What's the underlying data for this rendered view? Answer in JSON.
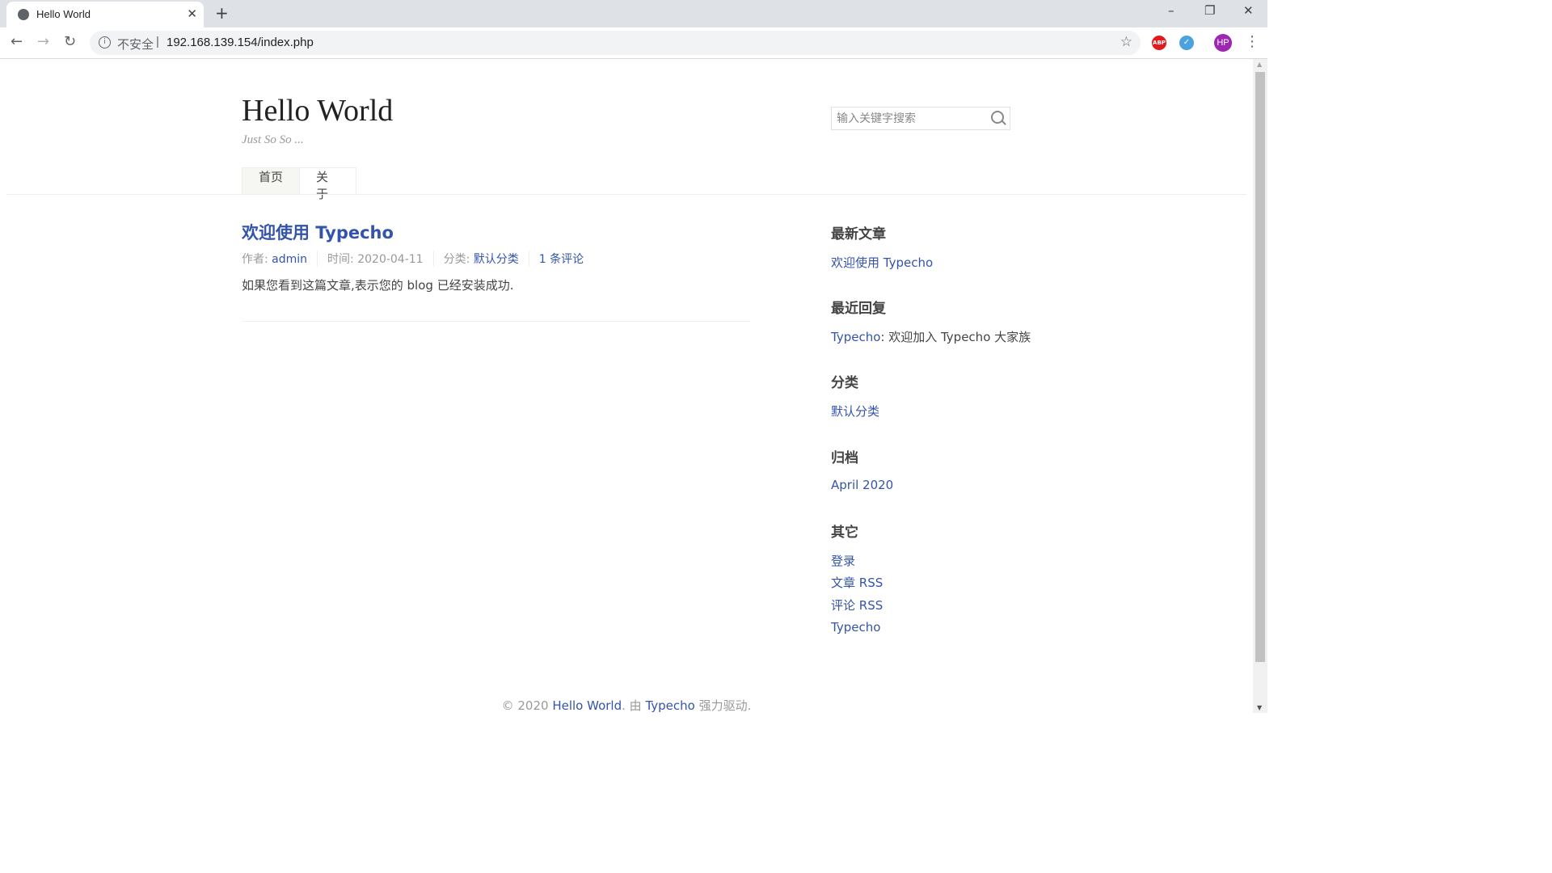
{
  "browser": {
    "tab_title": "Hello World",
    "tab_close": "✕",
    "new_tab": "+",
    "window": {
      "minimize": "–",
      "restore": "❐",
      "close": "✕"
    },
    "nav": {
      "back": "←",
      "forward": "→",
      "reload": "↻"
    },
    "info_icon": "i",
    "security_label": "不安全",
    "separator": "|",
    "url": "192.168.139.154/index.php",
    "bookmark_star": "☆",
    "extensions": {
      "abp": "ABP",
      "second": "✓"
    },
    "profile_initials": "HP",
    "menu": "⋮"
  },
  "site": {
    "title": "Hello World",
    "description": "Just So So ...",
    "search_placeholder": "输入关键字搜索",
    "nav": [
      {
        "label": "首页",
        "active": true
      },
      {
        "label": "关于",
        "active": false
      }
    ]
  },
  "post": {
    "title": "欢迎使用 Typecho",
    "author_label": "作者: ",
    "author": "admin",
    "time_label": "时间: ",
    "time": "2020-04-11",
    "category_label": "分类: ",
    "category": "默认分类",
    "comments": "1 条评论",
    "body": "如果您看到这篇文章,表示您的 blog 已经安装成功."
  },
  "sidebar": {
    "recent_posts": {
      "title": "最新文章",
      "items": [
        "欢迎使用 Typecho"
      ]
    },
    "recent_comments": {
      "title": "最近回复",
      "author": "Typecho",
      "text": ": 欢迎加入 Typecho 大家族"
    },
    "categories": {
      "title": "分类",
      "items": [
        "默认分类"
      ]
    },
    "archives": {
      "title": "归档",
      "items": [
        "April 2020"
      ]
    },
    "other": {
      "title": "其它",
      "items": [
        "登录",
        "文章 RSS",
        "评论 RSS",
        "Typecho"
      ]
    }
  },
  "footer": {
    "prefix": "© 2020 ",
    "site": "Hello World",
    "middle": ". 由 ",
    "powered": "Typecho",
    "suffix": " 强力驱动."
  }
}
